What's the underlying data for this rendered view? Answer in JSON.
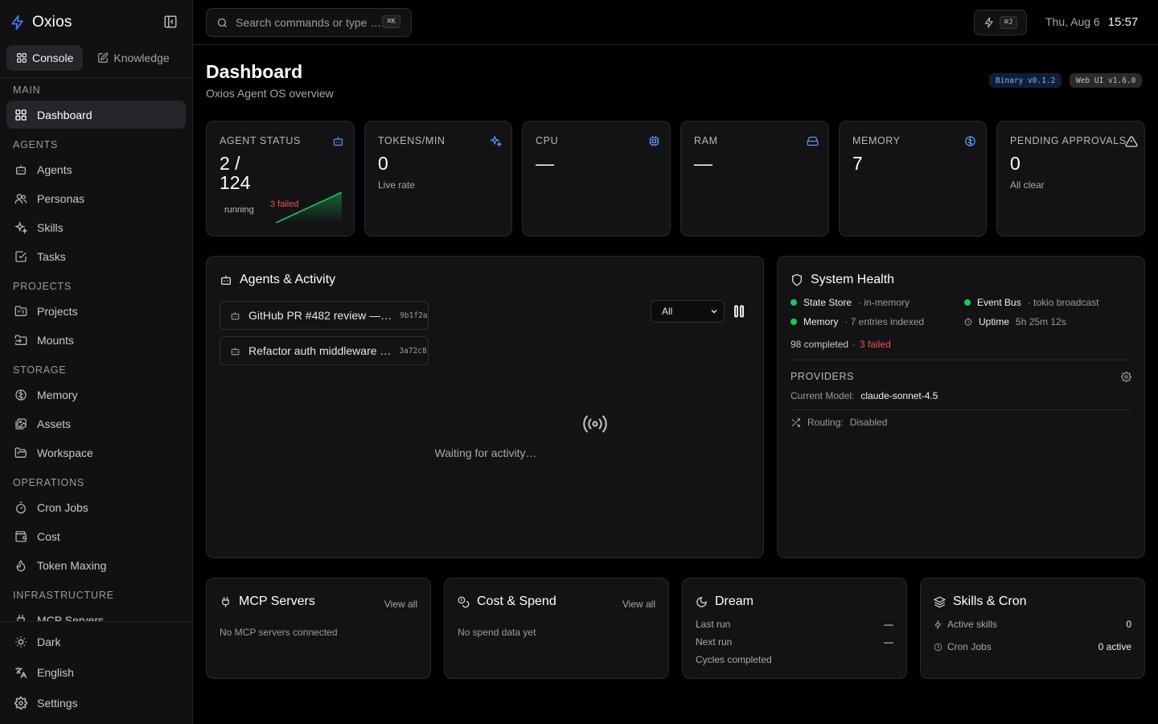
{
  "app": {
    "name": "Oxios"
  },
  "sidebar": {
    "tabs": [
      {
        "label": "Console"
      },
      {
        "label": "Knowledge"
      }
    ],
    "sections": {
      "main": "MAIN",
      "agents": "AGENTS",
      "projects": "PROJECTS",
      "storage": "STORAGE",
      "operations": "OPERATIONS",
      "infrastructure": "INFRASTRUCTURE"
    },
    "items": {
      "dashboard": "Dashboard",
      "agents": "Agents",
      "personas": "Personas",
      "skills": "Skills",
      "tasks": "Tasks",
      "projects": "Projects",
      "mounts": "Mounts",
      "memory": "Memory",
      "assets": "Assets",
      "workspace": "Workspace",
      "cron_jobs": "Cron Jobs",
      "cost": "Cost",
      "token_maxing": "Token Maxing",
      "mcp_servers": "MCP Servers"
    },
    "footer": {
      "theme": "Dark",
      "language": "English",
      "settings": "Settings"
    }
  },
  "topbar": {
    "search_placeholder": "Search commands or type …",
    "search_shortcut": "⌘K",
    "bolt_shortcut": "⌘J",
    "date": "Thu, Aug 6",
    "time": "15:57"
  },
  "page": {
    "title": "Dashboard",
    "subtitle": "Oxios Agent OS overview",
    "binary_version": "Binary v0.1.2",
    "webui_version": "Web UI v1.6.0"
  },
  "stats": {
    "agent_status": {
      "label": "AGENT STATUS",
      "value_line1": "2 /",
      "value_line2": "124",
      "running": "running",
      "failed": "3 failed"
    },
    "tokens": {
      "label": "TOKENS/MIN",
      "value": "0",
      "sub": "Live rate"
    },
    "cpu": {
      "label": "CPU",
      "value": "—"
    },
    "ram": {
      "label": "RAM",
      "value": "—"
    },
    "memory": {
      "label": "MEMORY",
      "value": "7"
    },
    "pending": {
      "label": "PENDING APPROVALS",
      "value": "0",
      "sub": "All clear"
    }
  },
  "activity": {
    "title": "Agents & Activity",
    "sessions": [
      {
        "name": "GitHub PR #482 review —…",
        "id": "9b1f2a"
      },
      {
        "name": "Refactor auth middleware …",
        "id": "3a72c8"
      }
    ],
    "filter_value": "All",
    "waiting": "Waiting for activity…"
  },
  "health": {
    "title": "System Health",
    "state_store": {
      "label": "State Store",
      "value": "· in-memory"
    },
    "event_bus": {
      "label": "Event Bus",
      "value": "· tokio broadcast"
    },
    "memory": {
      "label": "Memory",
      "value": "· 7 entries indexed"
    },
    "uptime": {
      "label": "Uptime",
      "value": "5h 25m 12s"
    },
    "tasks_completed": "98 completed",
    "tasks_sep": "·",
    "tasks_failed": "3 failed",
    "providers_label": "PROVIDERS",
    "current_model_label": "Current Model:",
    "current_model": "claude-sonnet-4.5",
    "routing_label": "Routing:",
    "routing_value": "Disabled"
  },
  "bottom": {
    "mcp": {
      "title": "MCP Servers",
      "view_all": "View all",
      "empty": "No MCP servers connected"
    },
    "cost": {
      "title": "Cost & Spend",
      "view_all": "View all",
      "empty": "No spend data yet"
    },
    "dream": {
      "title": "Dream",
      "last_run_label": "Last run",
      "last_run": "—",
      "next_run_label": "Next run",
      "next_run": "—",
      "cycles_label": "Cycles completed"
    },
    "skills_cron": {
      "title": "Skills & Cron",
      "active_skills_label": "Active skills",
      "active_skills": "0",
      "cron_label": "Cron Jobs",
      "cron_value": "0 active"
    }
  },
  "colors": {
    "accent": "#3b82f6",
    "success": "#22c55e",
    "danger": "#f05252",
    "background": "#000000",
    "surface": "#131316"
  }
}
